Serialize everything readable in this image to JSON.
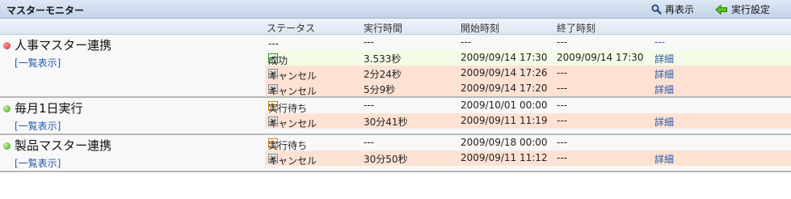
{
  "title": "マスターモニター",
  "toolbar": {
    "refresh_label": "再表示",
    "settings_label": "実行設定"
  },
  "columns": {
    "status": "ステータス",
    "exec": "実行時間",
    "start": "開始時刻",
    "end": "終了時刻"
  },
  "colors": {
    "success_row": "#f4fbe6",
    "cancel_row": "#fde2d4",
    "link": "#2858a8"
  },
  "groups": [
    {
      "name": "人事マスター連携",
      "state": "red",
      "link": "[一覧表示]",
      "rows": [
        {
          "type": "plain",
          "icon": "",
          "status": "---",
          "exec": "---",
          "start": "---",
          "end": "---",
          "detail": "---"
        },
        {
          "type": "success",
          "icon": "success-icon",
          "status": "成功",
          "exec": "3.533秒",
          "start": "2009/09/14 17:30",
          "end": "2009/09/14 17:30",
          "detail": "詳細"
        },
        {
          "type": "cancel",
          "icon": "cancel-icon",
          "status": "キャンセル",
          "exec": "2分24秒",
          "start": "2009/09/14 17:26",
          "end": "---",
          "detail": "詳細"
        },
        {
          "type": "cancel",
          "icon": "cancel-icon",
          "status": "キャンセル",
          "exec": "5分9秒",
          "start": "2009/09/14 17:20",
          "end": "---",
          "detail": "詳細"
        }
      ]
    },
    {
      "name": "毎月1日実行",
      "state": "green",
      "link": "[一覧表示]",
      "rows": [
        {
          "type": "plain",
          "icon": "clock-icon",
          "status": "実行待ち",
          "exec": "---",
          "start": "2009/10/01 00:00",
          "end": "---",
          "detail": ""
        },
        {
          "type": "cancel",
          "icon": "cancel-icon",
          "status": "キャンセル",
          "exec": "30分41秒",
          "start": "2009/09/11 11:19",
          "end": "---",
          "detail": "詳細"
        }
      ]
    },
    {
      "name": "製品マスター連携",
      "state": "green",
      "link": "[一覧表示]",
      "rows": [
        {
          "type": "plain",
          "icon": "clock-icon",
          "status": "実行待ち",
          "exec": "---",
          "start": "2009/09/18 00:00",
          "end": "---",
          "detail": ""
        },
        {
          "type": "cancel",
          "icon": "cancel-icon",
          "status": "キャンセル",
          "exec": "30分50秒",
          "start": "2009/09/11 11:12",
          "end": "---",
          "detail": "詳細"
        }
      ]
    }
  ]
}
